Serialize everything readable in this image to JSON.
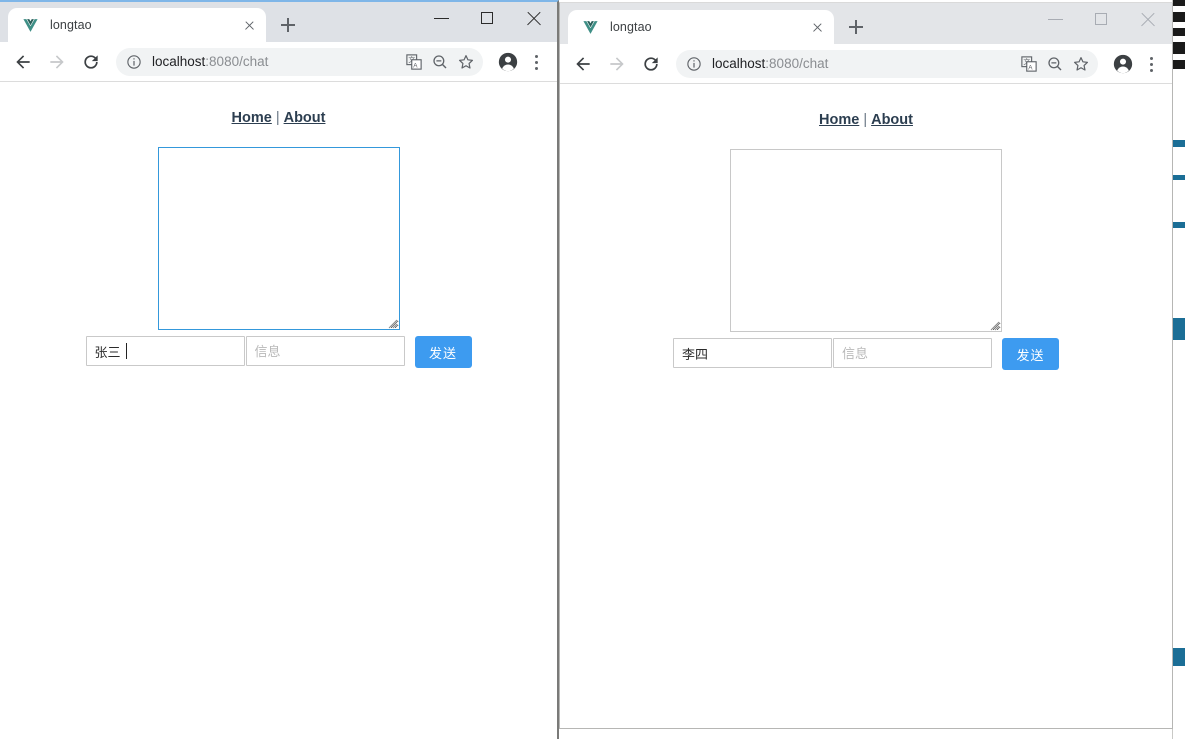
{
  "desktop": {
    "background_color": "#ffffff",
    "divider_color": "#b8b8b4",
    "artifact_color": "#1b6e96"
  },
  "windows": [
    {
      "id": "left",
      "active": true,
      "tab": {
        "title": "longtao",
        "favicon": "vue-logo-icon",
        "close_label": "close-tab"
      },
      "newtab_label": "new-tab",
      "controls": {
        "minimize": "minimize",
        "maximize": "maximize",
        "close": "close"
      },
      "toolbar": {
        "back": "back",
        "forward": "forward",
        "reload": "reload",
        "info_icon": "info-circle-icon",
        "url_host": "localhost",
        "url_path": ":8080/chat",
        "translate_icon": "translate-icon",
        "zoom_icon": "zoom-out-icon",
        "bookmark_icon": "star-icon",
        "profile_icon": "profile-avatar-icon",
        "menu_icon": "three-dot-menu-icon"
      },
      "page": {
        "nav": {
          "home": "Home",
          "separator": "|",
          "about": "About"
        },
        "messages_value": "",
        "messages_focused": true,
        "name_value": "张三",
        "name_placeholder": "",
        "message_value": "",
        "message_placeholder": "信息",
        "send_label": "发送",
        "send_color": "#3d9bf0"
      }
    },
    {
      "id": "right",
      "active": false,
      "tab": {
        "title": "longtao",
        "favicon": "vue-logo-icon",
        "close_label": "close-tab"
      },
      "newtab_label": "new-tab",
      "controls": {
        "minimize": "minimize",
        "maximize": "maximize",
        "close": "close"
      },
      "toolbar": {
        "back": "back",
        "forward": "forward",
        "reload": "reload",
        "info_icon": "info-circle-icon",
        "url_host": "localhost",
        "url_path": ":8080/chat",
        "translate_icon": "translate-icon",
        "zoom_icon": "zoom-out-icon",
        "bookmark_icon": "star-icon",
        "profile_icon": "profile-avatar-icon",
        "menu_icon": "three-dot-menu-icon"
      },
      "page": {
        "nav": {
          "home": "Home",
          "separator": "|",
          "about": "About"
        },
        "messages_value": "",
        "messages_focused": false,
        "name_value": "李四",
        "name_placeholder": "",
        "message_value": "",
        "message_placeholder": "信息",
        "send_label": "发送",
        "send_color": "#3d9bf0"
      }
    }
  ]
}
